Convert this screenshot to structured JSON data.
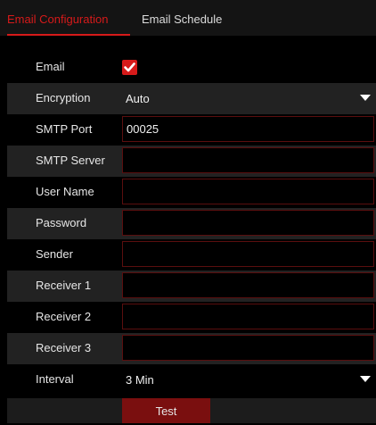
{
  "tabs": {
    "config_label": "Email Configuration",
    "schedule_label": "Email Schedule"
  },
  "form": {
    "email": {
      "label": "Email",
      "checked": true
    },
    "encryption": {
      "label": "Encryption",
      "value": "Auto"
    },
    "smtp_port": {
      "label": "SMTP Port",
      "value": "00025"
    },
    "smtp_server": {
      "label": "SMTP Server",
      "value": ""
    },
    "user_name": {
      "label": "User Name",
      "value": ""
    },
    "password": {
      "label": "Password",
      "value": ""
    },
    "sender": {
      "label": "Sender",
      "value": ""
    },
    "receiver1": {
      "label": "Receiver 1",
      "value": ""
    },
    "receiver2": {
      "label": "Receiver 2",
      "value": ""
    },
    "receiver3": {
      "label": "Receiver 3",
      "value": ""
    },
    "interval": {
      "label": "Interval",
      "value": "3 Min"
    }
  },
  "actions": {
    "test_label": "Test"
  },
  "colors": {
    "accent": "#d61a1a",
    "button": "#7a0f0f",
    "row_dark": "#222222",
    "field_border": "#5a0e0e"
  },
  "icons": {
    "checkbox_mark": "checkmark-icon",
    "dropdown": "caret-down-icon"
  }
}
